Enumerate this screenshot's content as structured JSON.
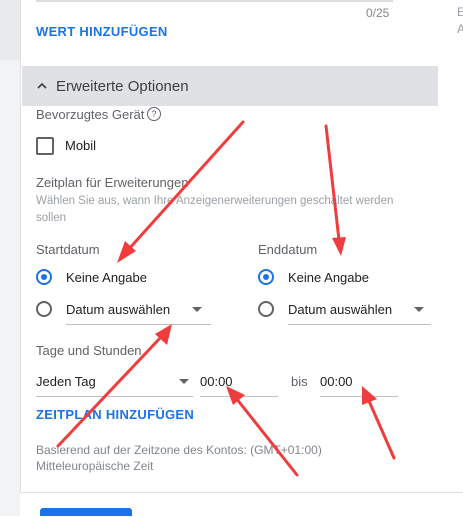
{
  "values_section": {
    "counter": "0/25",
    "add_value_link": "WERT HINZUFÜGEN"
  },
  "advanced": {
    "title": "Erweiterte Optionen",
    "preferred_device_label": "Bevorzugtes Gerät",
    "mobile_checkbox": {
      "label": "Mobil",
      "checked": false
    }
  },
  "schedule": {
    "title": "Zeitplan für Erweiterungen",
    "description": "Wählen Sie aus, wann Ihre Anzeigenerweiterungen geschaltet werden sollen",
    "start_date": {
      "label": "Startdatum",
      "options": [
        "Keine Angabe",
        "Datum auswählen"
      ],
      "selected": "Keine Angabe"
    },
    "end_date": {
      "label": "Enddatum",
      "options": [
        "Keine Angabe",
        "Datum auswählen"
      ],
      "selected": "Keine Angabe"
    },
    "days_hours": {
      "label": "Tage und Stunden",
      "day_value": "Jeden Tag",
      "from_time": "00:00",
      "to_word": "bis",
      "to_time": "00:00"
    },
    "add_schedule_link": "ZEITPLAN HINZUFÜGEN",
    "timezone_note_line1": "Basierend auf der Zeitzone des Kontos: (GMT+01:00)",
    "timezone_note_line2": "Mitteleuropäische Zeit"
  },
  "colors": {
    "accent": "#1a73e8",
    "annotation_arrow": "#f03c3c",
    "header_bg": "#dfe1e5"
  }
}
